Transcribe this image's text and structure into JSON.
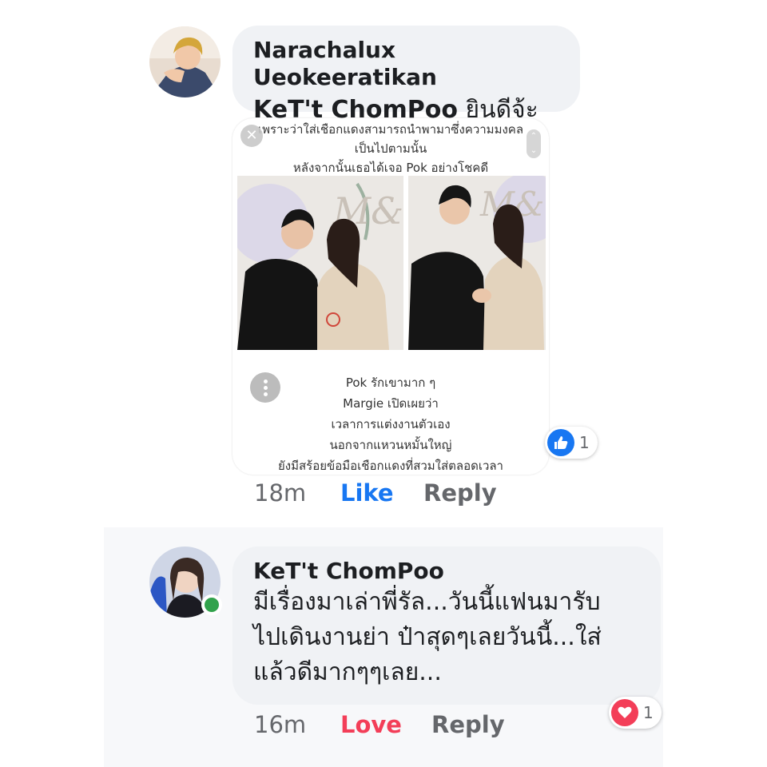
{
  "comments": [
    {
      "author": "Narachalux Ueokeeratikan",
      "mention": "KeT't ChomPoo",
      "message": " ยินดีจ้ะ",
      "attachment": {
        "caption_top": [
          "เพราะว่าใส่เชือกแดงสามารถนำพามาซึ่งความมงคล",
          "เป็นไปตามนั้น",
          "หลังจากนั้นเธอได้เจอ Pok อย่างโชคดี"
        ],
        "caption_bottom": [
          "Pok รักเขามาก ๆ",
          "Margie เปิดเผยว่า",
          "เวลาการแต่งงานตัวเอง",
          "นอกจากแหวนหมั้นใหญ่",
          "ยังมีสร้อยข้อมือเชือกแดงที่สวมใส่ตลอดเวลา"
        ]
      },
      "time": "18m",
      "like_label": "Like",
      "reply_label": "Reply",
      "reaction": {
        "icon": "thumbs-up-icon",
        "count": "1",
        "color": "#1877f2"
      }
    },
    {
      "author": "KeT't ChomPoo",
      "lines": [
        "มีเรื่องมาเล่าพี่รัล...วันนี้แฟนมารับ",
        "ไปเดินงานย่า ป๋าสุดๆเลยวันนี้...ใส่",
        "แล้วดีมากๆๆเลย..."
      ],
      "time": "16m",
      "love_label": "Love",
      "reply_label": "Reply",
      "reaction": {
        "icon": "heart-icon",
        "count": "1",
        "color": "#f33e58"
      },
      "online": true
    }
  ]
}
